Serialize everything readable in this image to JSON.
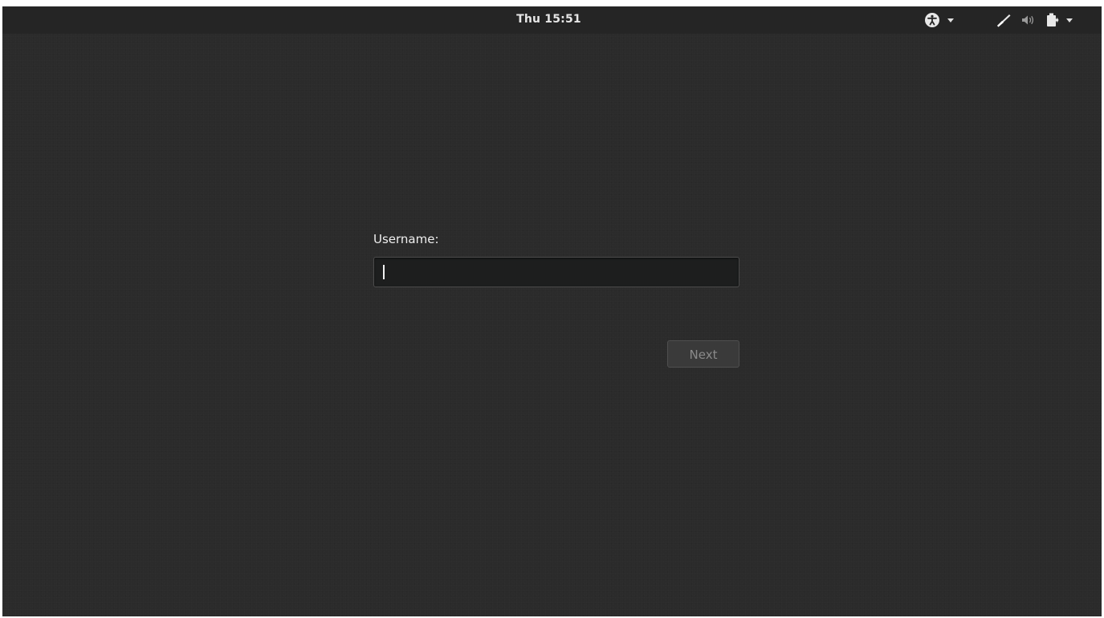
{
  "topbar": {
    "clock": "Thu 15:51",
    "tray_icons": {
      "accessibility": "accessibility-icon",
      "accessibility_menu": "chevron-down-icon",
      "network": "signal-icon",
      "volume": "volume-icon",
      "power": "battery-icon",
      "system_menu": "chevron-down-icon"
    }
  },
  "login": {
    "username_label": "Username:",
    "username_value": "",
    "next_label": "Next"
  },
  "colors": {
    "background": "#2b2b2b",
    "text": "#eeeeee",
    "button_disabled_text": "#8a8a8a"
  }
}
